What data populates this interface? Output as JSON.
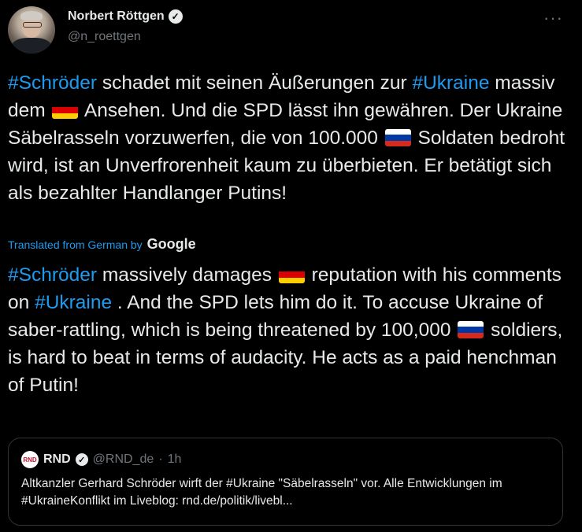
{
  "author": {
    "display_name": "Norbert Röttgen",
    "handle": "@n_roettgen",
    "verified_glyph": "✓"
  },
  "more_glyph": "···",
  "original": {
    "parts": [
      {
        "t": "#Schröder",
        "tag": true
      },
      {
        "t": " schadet mit seinen Äußerungen zur "
      },
      {
        "t": "#Ukraine",
        "tag": true
      },
      {
        "t": " massiv dem "
      },
      {
        "flag": "de"
      },
      {
        "t": " Ansehen. Und die SPD lässt ihn gewähren. Der Ukraine Säbelrasseln vorzuwerfen, die von 100.000 "
      },
      {
        "flag": "ru"
      },
      {
        "t": " Soldaten bedroht wird, ist an Unverfrorenheit kaum zu überbieten. Er betätigt sich als bezahlter Handlanger Putins!"
      }
    ]
  },
  "translation": {
    "label": "Translated from German by",
    "provider": "Google",
    "parts": [
      {
        "t": "#Schröder",
        "tag": true
      },
      {
        "t": " massively damages "
      },
      {
        "flag": "de"
      },
      {
        "t": " reputation with his comments on "
      },
      {
        "t": "#Ukraine",
        "tag": true
      },
      {
        "t": " . And the SPD lets him do it. To accuse Ukraine of saber-rattling, which is being threatened by 100,000 "
      },
      {
        "flag": "ru"
      },
      {
        "t": " soldiers, is hard to beat in terms of audacity. He acts as a paid henchman of Putin!"
      }
    ]
  },
  "quote": {
    "avatar_label": "RND",
    "name": "RND",
    "handle": "@RND_de",
    "separator": "·",
    "time": "1h",
    "text": "Altkanzler Gerhard Schröder wirft der #Ukraine \"Säbelrasseln\" vor. Alle Entwicklungen im #UkraineKonflikt im Liveblog: rnd.de/politik/livebl..."
  },
  "colors": {
    "background": "#000000",
    "link": "#1d9bf0",
    "text": "#e7e9ea",
    "muted": "#71767b",
    "flag_de": [
      "#000000",
      "#dd0000",
      "#ffce00"
    ],
    "flag_ru": [
      "#ffffff",
      "#0039a6",
      "#d52b1e"
    ]
  }
}
